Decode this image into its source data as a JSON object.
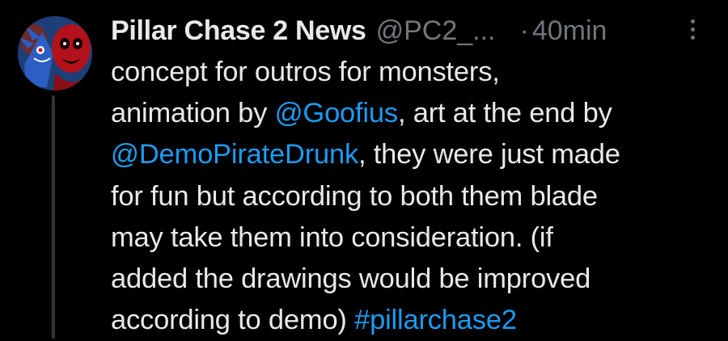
{
  "tweet": {
    "author_name": "Pillar Chase 2 News",
    "handle": "@PC2_...",
    "separator": "·",
    "time": "40min",
    "more_icon": "more-vertical-icon",
    "avatar_icon": "profile-avatar",
    "lines": [
      [
        {
          "text": "concept for outros for monsters,",
          "link": false
        }
      ],
      [
        {
          "text": "animation by ",
          "link": false
        },
        {
          "text": "@Goofius",
          "link": true
        },
        {
          "text": ", art at the end by",
          "link": false
        }
      ],
      [
        {
          "text": "@DemoPirateDrunk",
          "link": true
        },
        {
          "text": ", they were just made",
          "link": false
        }
      ],
      [
        {
          "text": "for fun but according to both them blade",
          "link": false
        }
      ],
      [
        {
          "text": "may take them into consideration. (if",
          "link": false
        }
      ],
      [
        {
          "text": "added the drawings would be improved",
          "link": false
        }
      ],
      [
        {
          "text": "according to demo) ",
          "link": false
        },
        {
          "text": "#pillarchase2",
          "link": true
        }
      ]
    ]
  },
  "colors": {
    "background": "#000000",
    "text_primary": "#e7e9ea",
    "text_secondary": "#71767b",
    "link": "#1d9bf0",
    "thread_line": "#333639"
  }
}
